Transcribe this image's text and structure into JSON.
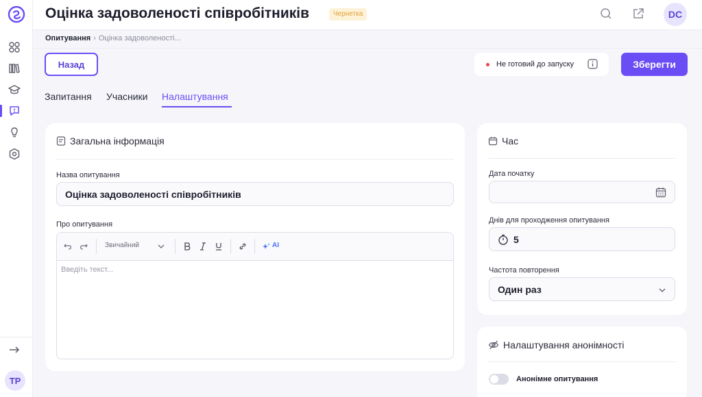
{
  "header": {
    "title": "Оцінка задоволеності співробітників",
    "status": "Чернетка",
    "avatar": "DC"
  },
  "sidebar": {
    "user_avatar": "TP"
  },
  "breadcrumb": {
    "root": "Опитування",
    "current": "Оцінка задоволеності..."
  },
  "actions": {
    "back_label": "Назад",
    "ready_status": "Не готовий до запуску",
    "save_label": "Зберегти"
  },
  "tabs": [
    {
      "label": "Запитання"
    },
    {
      "label": "Учасники"
    },
    {
      "label": "Налаштування",
      "active": true
    }
  ],
  "general": {
    "title": "Загальна інформація",
    "name_label": "Назва опитування",
    "name_value": "Оцінка задоволеності співробітників",
    "about_label": "Про опитування",
    "editor_style": "Звичайний",
    "ai_label": "AI",
    "editor_placeholder": "Введіть текст..."
  },
  "time": {
    "title": "Час",
    "start_date_label": "Дата початку",
    "start_date_value": "",
    "days_label": "Днів для проходження опитування",
    "days_value": "5",
    "frequency_label": "Частота повторення",
    "frequency_value": "Один раз"
  },
  "anonymity": {
    "title": "Налаштування анонімності",
    "toggle_label": "Анонімне опитування",
    "enabled": false
  },
  "colors": {
    "accent": "#6a4df4",
    "badge_bg": "#fdf2d6",
    "badge_text": "#e2a23a",
    "error_dot": "#e5484d"
  }
}
